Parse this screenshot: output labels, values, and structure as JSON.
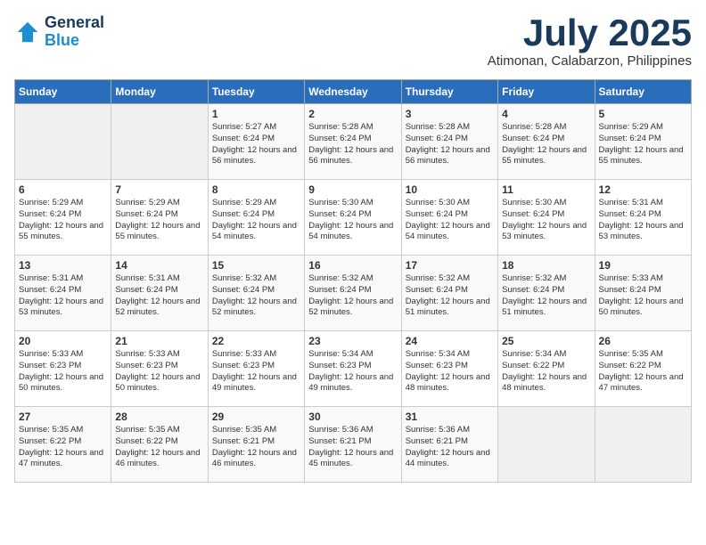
{
  "header": {
    "logo_line1": "General",
    "logo_line2": "Blue",
    "month": "July 2025",
    "location": "Atimonan, Calabarzon, Philippines"
  },
  "days_of_week": [
    "Sunday",
    "Monday",
    "Tuesday",
    "Wednesday",
    "Thursday",
    "Friday",
    "Saturday"
  ],
  "weeks": [
    [
      {
        "day": "",
        "sunrise": "",
        "sunset": "",
        "daylight": ""
      },
      {
        "day": "",
        "sunrise": "",
        "sunset": "",
        "daylight": ""
      },
      {
        "day": "1",
        "sunrise": "Sunrise: 5:27 AM",
        "sunset": "Sunset: 6:24 PM",
        "daylight": "Daylight: 12 hours and 56 minutes."
      },
      {
        "day": "2",
        "sunrise": "Sunrise: 5:28 AM",
        "sunset": "Sunset: 6:24 PM",
        "daylight": "Daylight: 12 hours and 56 minutes."
      },
      {
        "day": "3",
        "sunrise": "Sunrise: 5:28 AM",
        "sunset": "Sunset: 6:24 PM",
        "daylight": "Daylight: 12 hours and 56 minutes."
      },
      {
        "day": "4",
        "sunrise": "Sunrise: 5:28 AM",
        "sunset": "Sunset: 6:24 PM",
        "daylight": "Daylight: 12 hours and 55 minutes."
      },
      {
        "day": "5",
        "sunrise": "Sunrise: 5:29 AM",
        "sunset": "Sunset: 6:24 PM",
        "daylight": "Daylight: 12 hours and 55 minutes."
      }
    ],
    [
      {
        "day": "6",
        "sunrise": "Sunrise: 5:29 AM",
        "sunset": "Sunset: 6:24 PM",
        "daylight": "Daylight: 12 hours and 55 minutes."
      },
      {
        "day": "7",
        "sunrise": "Sunrise: 5:29 AM",
        "sunset": "Sunset: 6:24 PM",
        "daylight": "Daylight: 12 hours and 55 minutes."
      },
      {
        "day": "8",
        "sunrise": "Sunrise: 5:29 AM",
        "sunset": "Sunset: 6:24 PM",
        "daylight": "Daylight: 12 hours and 54 minutes."
      },
      {
        "day": "9",
        "sunrise": "Sunrise: 5:30 AM",
        "sunset": "Sunset: 6:24 PM",
        "daylight": "Daylight: 12 hours and 54 minutes."
      },
      {
        "day": "10",
        "sunrise": "Sunrise: 5:30 AM",
        "sunset": "Sunset: 6:24 PM",
        "daylight": "Daylight: 12 hours and 54 minutes."
      },
      {
        "day": "11",
        "sunrise": "Sunrise: 5:30 AM",
        "sunset": "Sunset: 6:24 PM",
        "daylight": "Daylight: 12 hours and 53 minutes."
      },
      {
        "day": "12",
        "sunrise": "Sunrise: 5:31 AM",
        "sunset": "Sunset: 6:24 PM",
        "daylight": "Daylight: 12 hours and 53 minutes."
      }
    ],
    [
      {
        "day": "13",
        "sunrise": "Sunrise: 5:31 AM",
        "sunset": "Sunset: 6:24 PM",
        "daylight": "Daylight: 12 hours and 53 minutes."
      },
      {
        "day": "14",
        "sunrise": "Sunrise: 5:31 AM",
        "sunset": "Sunset: 6:24 PM",
        "daylight": "Daylight: 12 hours and 52 minutes."
      },
      {
        "day": "15",
        "sunrise": "Sunrise: 5:32 AM",
        "sunset": "Sunset: 6:24 PM",
        "daylight": "Daylight: 12 hours and 52 minutes."
      },
      {
        "day": "16",
        "sunrise": "Sunrise: 5:32 AM",
        "sunset": "Sunset: 6:24 PM",
        "daylight": "Daylight: 12 hours and 52 minutes."
      },
      {
        "day": "17",
        "sunrise": "Sunrise: 5:32 AM",
        "sunset": "Sunset: 6:24 PM",
        "daylight": "Daylight: 12 hours and 51 minutes."
      },
      {
        "day": "18",
        "sunrise": "Sunrise: 5:32 AM",
        "sunset": "Sunset: 6:24 PM",
        "daylight": "Daylight: 12 hours and 51 minutes."
      },
      {
        "day": "19",
        "sunrise": "Sunrise: 5:33 AM",
        "sunset": "Sunset: 6:24 PM",
        "daylight": "Daylight: 12 hours and 50 minutes."
      }
    ],
    [
      {
        "day": "20",
        "sunrise": "Sunrise: 5:33 AM",
        "sunset": "Sunset: 6:23 PM",
        "daylight": "Daylight: 12 hours and 50 minutes."
      },
      {
        "day": "21",
        "sunrise": "Sunrise: 5:33 AM",
        "sunset": "Sunset: 6:23 PM",
        "daylight": "Daylight: 12 hours and 50 minutes."
      },
      {
        "day": "22",
        "sunrise": "Sunrise: 5:33 AM",
        "sunset": "Sunset: 6:23 PM",
        "daylight": "Daylight: 12 hours and 49 minutes."
      },
      {
        "day": "23",
        "sunrise": "Sunrise: 5:34 AM",
        "sunset": "Sunset: 6:23 PM",
        "daylight": "Daylight: 12 hours and 49 minutes."
      },
      {
        "day": "24",
        "sunrise": "Sunrise: 5:34 AM",
        "sunset": "Sunset: 6:23 PM",
        "daylight": "Daylight: 12 hours and 48 minutes."
      },
      {
        "day": "25",
        "sunrise": "Sunrise: 5:34 AM",
        "sunset": "Sunset: 6:22 PM",
        "daylight": "Daylight: 12 hours and 48 minutes."
      },
      {
        "day": "26",
        "sunrise": "Sunrise: 5:35 AM",
        "sunset": "Sunset: 6:22 PM",
        "daylight": "Daylight: 12 hours and 47 minutes."
      }
    ],
    [
      {
        "day": "27",
        "sunrise": "Sunrise: 5:35 AM",
        "sunset": "Sunset: 6:22 PM",
        "daylight": "Daylight: 12 hours and 47 minutes."
      },
      {
        "day": "28",
        "sunrise": "Sunrise: 5:35 AM",
        "sunset": "Sunset: 6:22 PM",
        "daylight": "Daylight: 12 hours and 46 minutes."
      },
      {
        "day": "29",
        "sunrise": "Sunrise: 5:35 AM",
        "sunset": "Sunset: 6:21 PM",
        "daylight": "Daylight: 12 hours and 46 minutes."
      },
      {
        "day": "30",
        "sunrise": "Sunrise: 5:36 AM",
        "sunset": "Sunset: 6:21 PM",
        "daylight": "Daylight: 12 hours and 45 minutes."
      },
      {
        "day": "31",
        "sunrise": "Sunrise: 5:36 AM",
        "sunset": "Sunset: 6:21 PM",
        "daylight": "Daylight: 12 hours and 44 minutes."
      },
      {
        "day": "",
        "sunrise": "",
        "sunset": "",
        "daylight": ""
      },
      {
        "day": "",
        "sunrise": "",
        "sunset": "",
        "daylight": ""
      }
    ]
  ]
}
